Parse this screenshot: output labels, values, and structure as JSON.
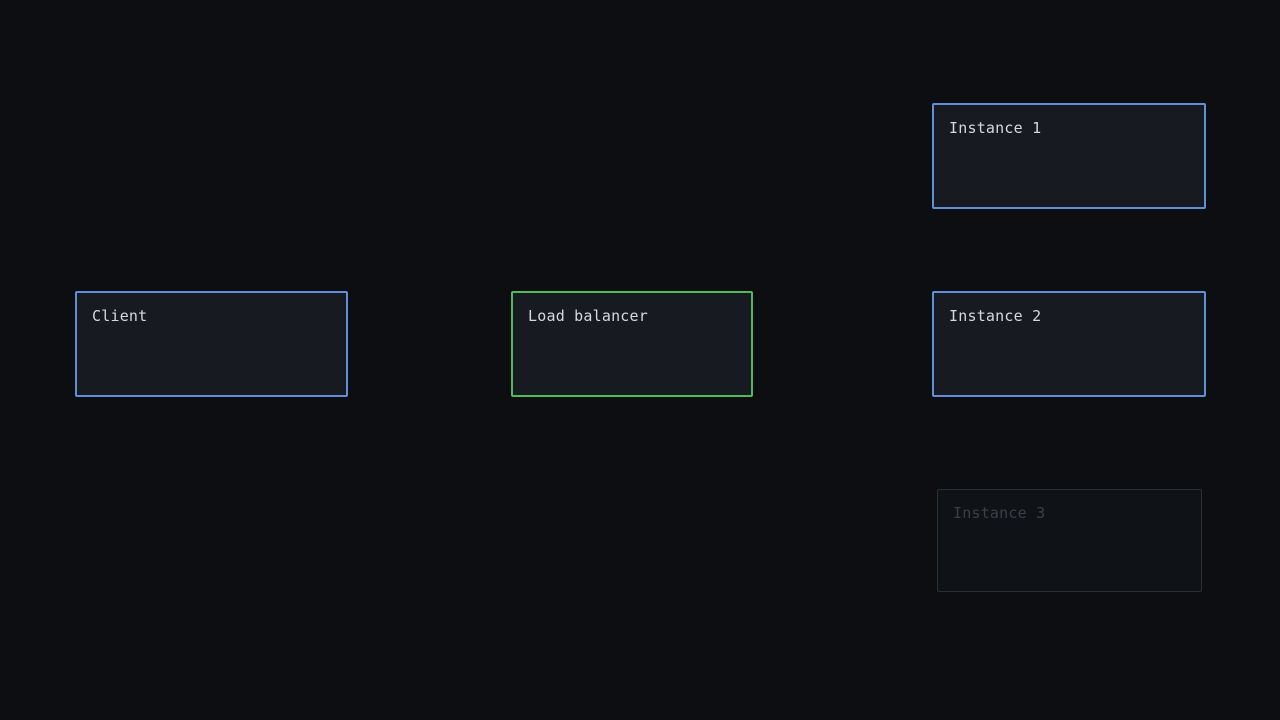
{
  "diagram": {
    "nodes": {
      "client": {
        "label": "Client"
      },
      "load_balancer": {
        "label": "Load balancer"
      },
      "instance_1": {
        "label": "Instance 1"
      },
      "instance_2": {
        "label": "Instance 2"
      },
      "instance_3": {
        "label": "Instance 3",
        "state": "faded"
      }
    },
    "colors": {
      "background": "#0c0e11",
      "node_fill": "#171b21",
      "client_border": "#5f8fd6",
      "load_balancer_border": "#4fb85a",
      "instance_border": "#5f8fd6",
      "faded_border": "#2a2f36",
      "label_text": "#d5d9de"
    }
  }
}
